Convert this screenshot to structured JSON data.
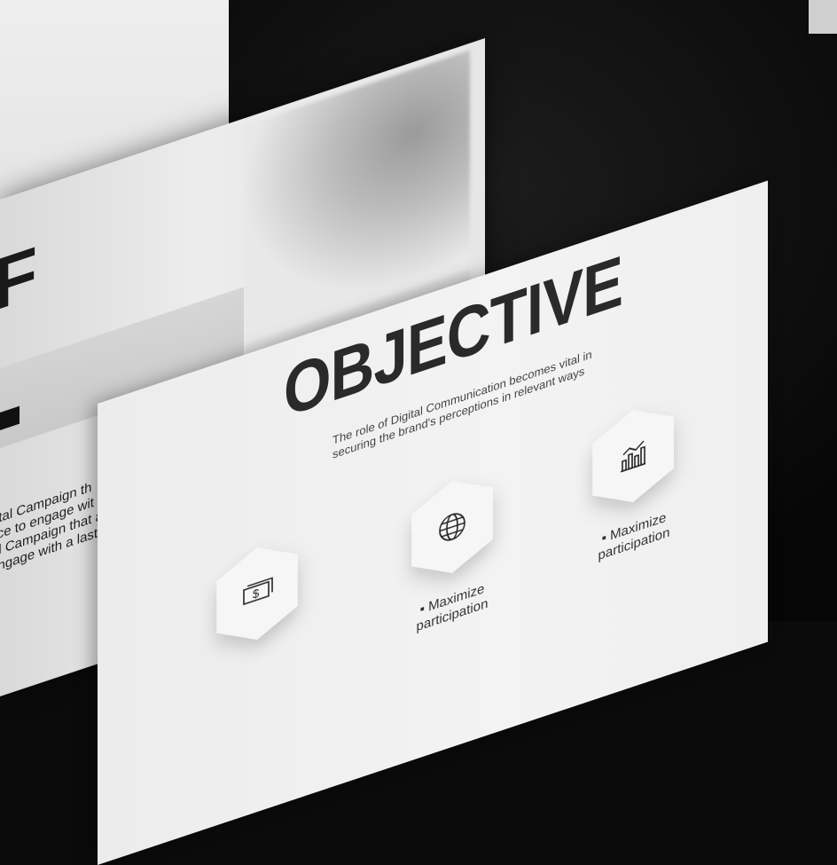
{
  "back_slide": {
    "heading_letter": "F",
    "body_lines": [
      "a Digital Campaign th",
      "udience to engage wit",
      "Digital Campaign that a",
      "e to engage with a last"
    ]
  },
  "main_slide": {
    "title": "OBJECTIVE",
    "subtitle_lines": [
      "The role of Digital Communication becomes vital in",
      "securing the brand's perceptions in relevant ways"
    ],
    "cards": [
      {
        "icon": "money-icon",
        "label": ""
      },
      {
        "icon": "globe-icon",
        "label": "▪ Maximize participation"
      },
      {
        "icon": "chart-icon",
        "label": "▪ Maximize participation"
      }
    ]
  },
  "colors": {
    "background": "#0b0b0b",
    "slide": "#efefef",
    "title": "#2a2a2a"
  }
}
